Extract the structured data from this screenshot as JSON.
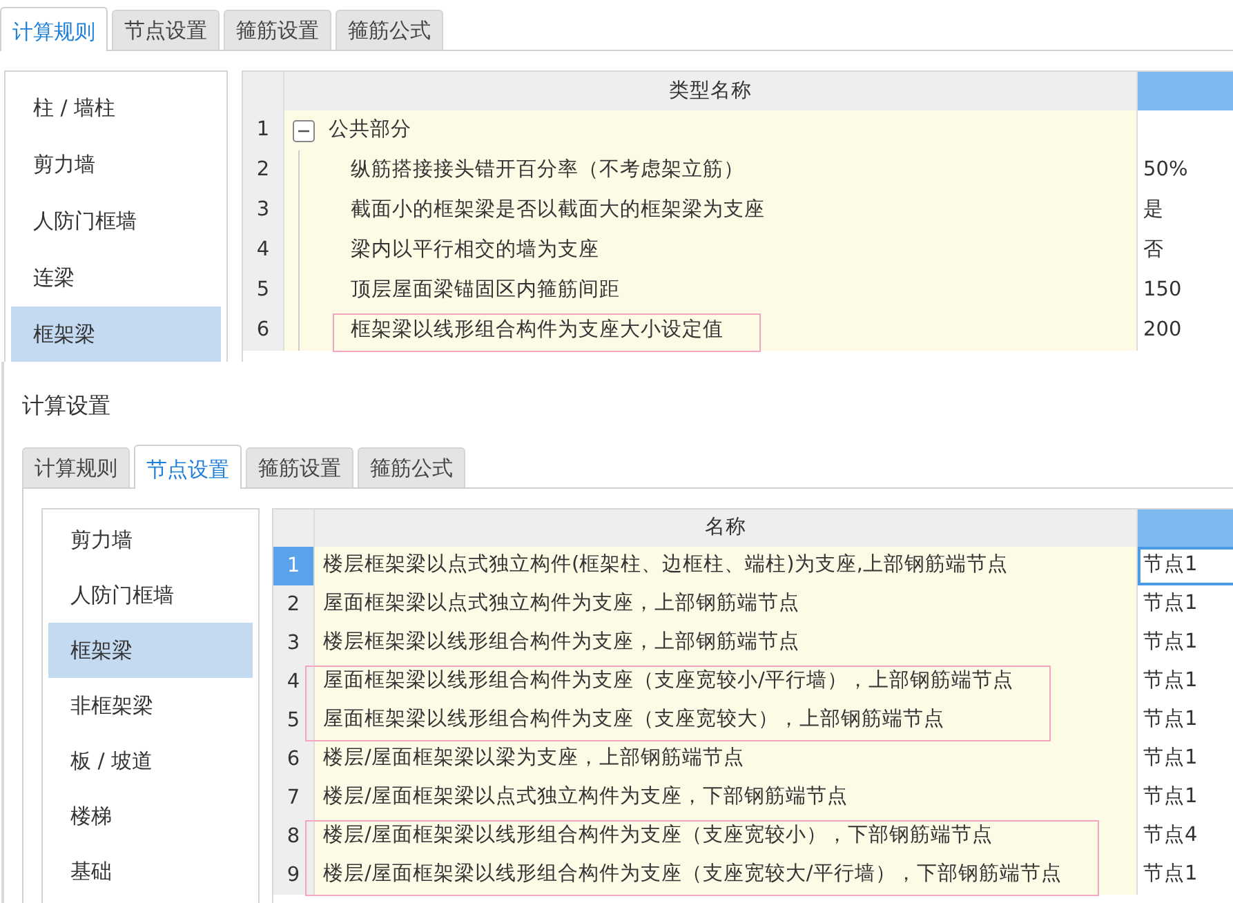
{
  "top_panel": {
    "tabs": [
      {
        "label": "计算规则",
        "selected": true
      },
      {
        "label": "节点设置",
        "selected": false
      },
      {
        "label": "箍筋设置",
        "selected": false
      },
      {
        "label": "箍筋公式",
        "selected": false
      }
    ],
    "sidebar": {
      "items": [
        {
          "label": "柱 / 墙柱",
          "selected": false
        },
        {
          "label": "剪力墙",
          "selected": false
        },
        {
          "label": "人防门框墙",
          "selected": false
        },
        {
          "label": "连梁",
          "selected": false
        },
        {
          "label": "框架梁",
          "selected": true
        }
      ]
    },
    "table": {
      "columns": [
        {
          "label": "类型名称",
          "selected": false
        },
        {
          "selected": true
        }
      ],
      "rows": [
        {
          "number": "1",
          "name": "公共部分",
          "expanded": true,
          "highlighted": false,
          "children": [
            {
              "number": "2",
              "name": "纵筋搭接接头错开百分率（不考虑架立筋）",
              "value": "50%",
              "highlighted": false
            },
            {
              "number": "3",
              "name": "截面小的框架梁是否以截面大的框架梁为支座",
              "value": "是",
              "highlighted": false
            },
            {
              "number": "4",
              "name": "梁内以平行相交的墙为支座",
              "value": "否",
              "highlighted": false
            },
            {
              "number": "5",
              "name": "顶层屋面梁锚固区内箍筋间距",
              "value": "150",
              "highlighted": false
            },
            {
              "number": "6",
              "name": "框架梁以线形组合构件为支座大小设定值",
              "value": "200",
              "highlighted": true
            }
          ]
        }
      ]
    }
  },
  "bottom_panel": {
    "title": "计算设置",
    "tabs": [
      {
        "label": "计算规则",
        "selected": false
      },
      {
        "label": "节点设置",
        "selected": true
      },
      {
        "label": "箍筋设置",
        "selected": false
      },
      {
        "label": "箍筋公式",
        "selected": false
      }
    ],
    "sidebar": {
      "items": [
        {
          "label": "剪力墙",
          "selected": false
        },
        {
          "label": "人防门框墙",
          "selected": false
        },
        {
          "label": "框架梁",
          "selected": true
        },
        {
          "label": "非框架梁",
          "selected": false
        },
        {
          "label": "板 / 坡道",
          "selected": false
        },
        {
          "label": "楼梯",
          "selected": false
        },
        {
          "label": "基础",
          "selected": false
        }
      ]
    },
    "table": {
      "columns": [
        {
          "label": "名称",
          "selected": false
        },
        {
          "selected": true
        }
      ],
      "rows": [
        {
          "number": "1",
          "name": "楼层框架梁以点式独立构件(框架柱、边框柱、端柱)为支座,上部钢筋端节点",
          "value": "节点1",
          "selected": true,
          "highlighted": false
        },
        {
          "number": "2",
          "name": "屋面框架梁以点式独立构件为支座，上部钢筋端节点",
          "value": "节点1",
          "selected": false,
          "highlighted": false
        },
        {
          "number": "3",
          "name": "楼层框架梁以线形组合构件为支座，上部钢筋端节点",
          "value": "节点1",
          "selected": false,
          "highlighted": false
        },
        {
          "number": "4",
          "name": "屋面框架梁以线形组合构件为支座（支座宽较小/平行墙），上部钢筋端节点",
          "value": "节点1",
          "selected": false,
          "highlighted": true
        },
        {
          "number": "5",
          "name": "屋面框架梁以线形组合构件为支座（支座宽较大），上部钢筋端节点",
          "value": "节点1",
          "selected": false,
          "highlighted": true
        },
        {
          "number": "6",
          "name": "楼层/屋面框架梁以梁为支座，上部钢筋端节点",
          "value": "节点1",
          "selected": false,
          "highlighted": false
        },
        {
          "number": "7",
          "name": "楼层/屋面框架梁以点式独立构件为支座，下部钢筋端节点",
          "value": "节点1",
          "selected": false,
          "highlighted": false
        },
        {
          "number": "8",
          "name": "楼层/屋面框架梁以线形组合构件为支座（支座宽较小），下部钢筋端节点",
          "value": "节点4",
          "selected": false,
          "highlighted": true
        },
        {
          "number": "9",
          "name": "楼层/屋面框架梁以线形组合构件为支座（支座宽较大/平行墙），下部钢筋端节点",
          "value": "节点1",
          "selected": false,
          "highlighted": true
        }
      ]
    }
  }
}
